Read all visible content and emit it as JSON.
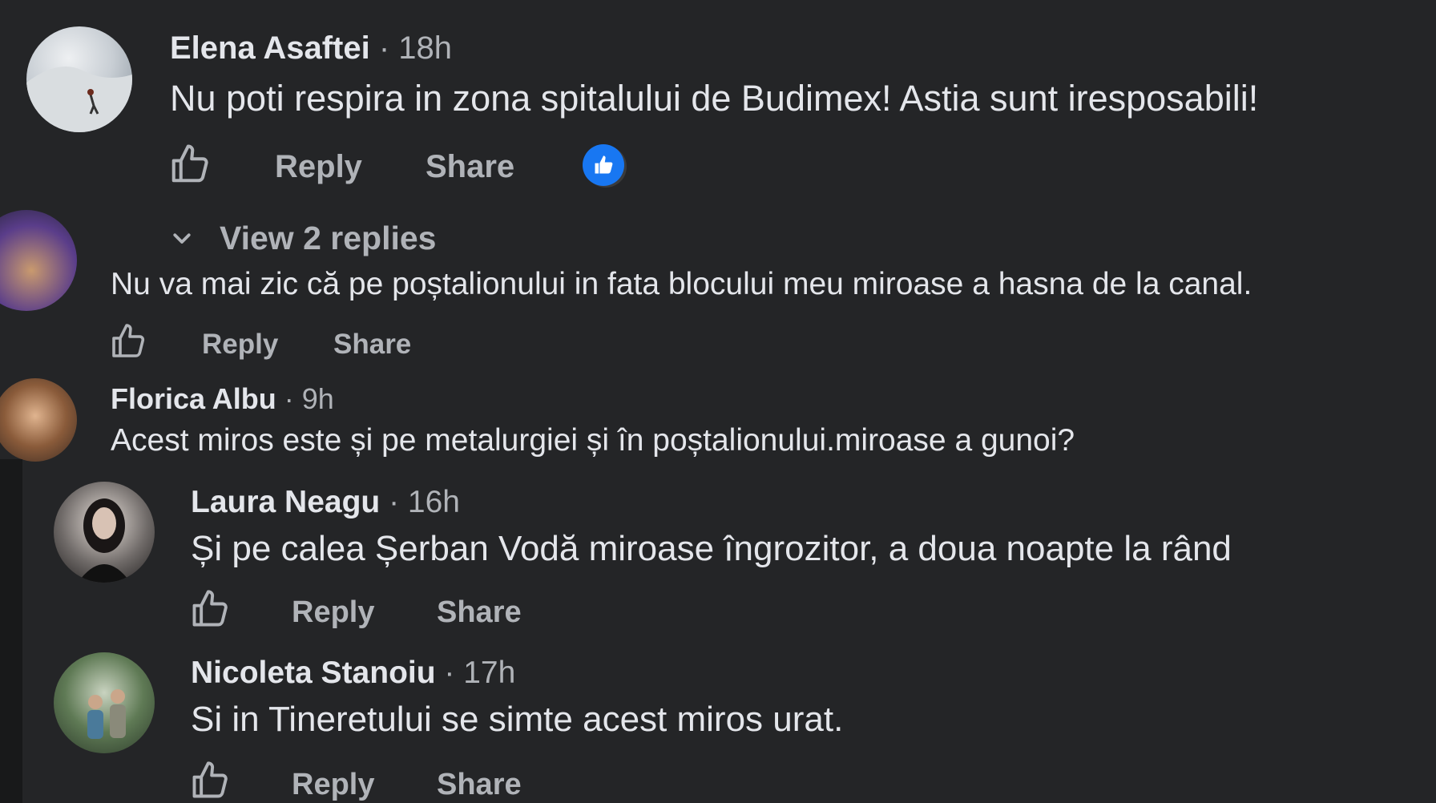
{
  "colors": {
    "background": "#242527",
    "primary_text": "#e4e6eb",
    "secondary_text": "#b0b3b8",
    "reaction_blue": "#1877f2"
  },
  "comments": [
    {
      "author": "Elena Asaftei",
      "time": "· 18h",
      "text": "Nu poti respira in zona spitalului de Budimex! Astia sunt iresposabili!",
      "reply_label": "Reply",
      "share_label": "Share",
      "reaction_icon": "like-reaction-icon",
      "view_replies_label": "View 2 replies"
    },
    {
      "author": "",
      "time": "",
      "text": "Nu va mai zic că pe poștalionului in fata blocului meu miroase a hasna de la canal.",
      "reply_label": "Reply",
      "share_label": "Share"
    },
    {
      "author": "Florica Albu",
      "time": "· 9h",
      "text": "Acest miros este și pe metalurgiei și în poștalionului.miroase a gunoi?"
    }
  ],
  "replies": [
    {
      "author": "Laura Neagu",
      "time": "· 16h",
      "text": "Și pe calea Șerban Vodă miroase îngrozitor, a doua noapte la rând",
      "reply_label": "Reply",
      "share_label": "Share"
    },
    {
      "author": "Nicoleta Stanoiu",
      "time": "· 17h",
      "text": "Si in Tineretului se simte acest miros urat.",
      "reply_label": "Reply",
      "share_label": "Share"
    }
  ]
}
